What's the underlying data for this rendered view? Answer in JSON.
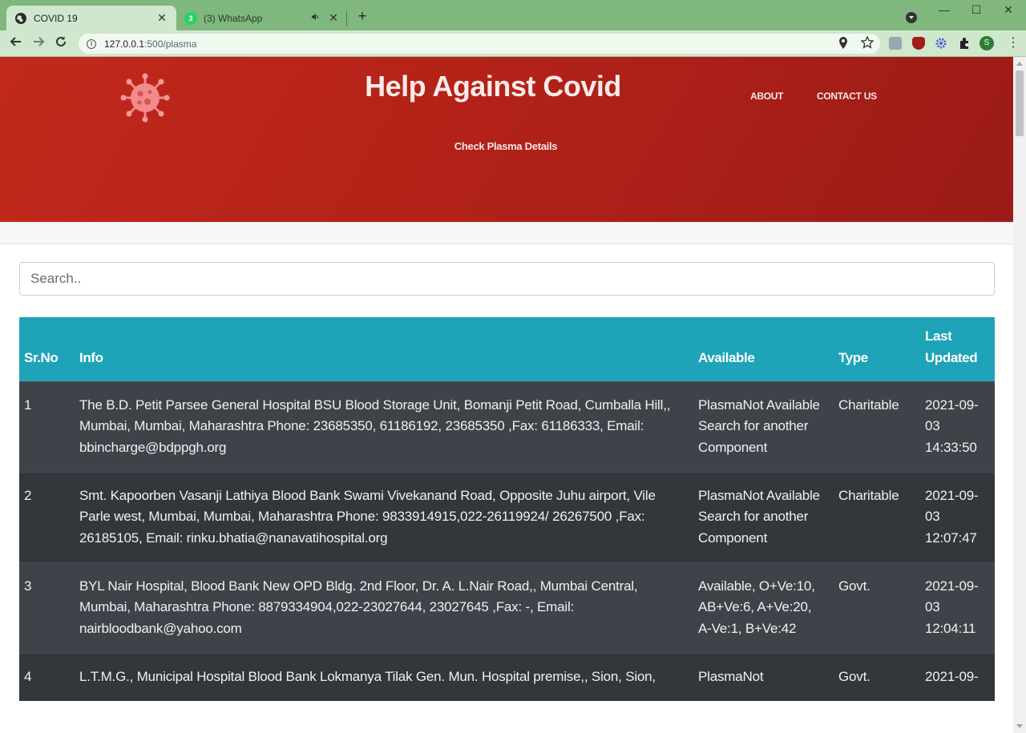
{
  "browser": {
    "tabs": [
      {
        "title": "COVID 19",
        "close": "✕"
      },
      {
        "title": "(3) WhatsApp",
        "badge": "3",
        "close": "✕"
      }
    ],
    "new_tab": "+",
    "url_host": "127.0.0.1",
    "url_rest": ":500/plasma",
    "profile_initial": "S",
    "window_controls": {
      "minimize": "—",
      "maximize": "☐",
      "close": "✕"
    }
  },
  "site": {
    "brand": "Help Against Covid",
    "nav": {
      "about": "ABOUT",
      "contact": "CONTACT US"
    },
    "plasma_link": "Check Plasma Details"
  },
  "search": {
    "placeholder": "Search.."
  },
  "table": {
    "headers": {
      "srno": "Sr.No",
      "info": "Info",
      "available": "Available",
      "type": "Type",
      "updated": "Last Updated"
    },
    "rows": [
      {
        "srno": "1",
        "info": "The B.D. Petit Parsee General Hospital BSU Blood Storage Unit, Bomanji Petit Road, Cumballa Hill,, Mumbai, Mumbai, Maharashtra Phone: 23685350, 61186192, 23685350 ,Fax: 61186333, Email: bbincharge@bdppgh.org",
        "available": "PlasmaNot Available Search for another Component",
        "type": "Charitable",
        "updated": "2021-09-03 14:33:50"
      },
      {
        "srno": "2",
        "info": "Smt. Kapoorben Vasanji Lathiya Blood Bank Swami Vivekanand Road, Opposite Juhu airport, Vile Parle west, Mumbai, Mumbai, Maharashtra Phone: 9833914915,022-26119924/ 26267500 ,Fax: 26185105, Email: rinku.bhatia@nanavatihospital.org",
        "available": "PlasmaNot Available Search for another Component",
        "type": "Charitable",
        "updated": "2021-09-03 12:07:47"
      },
      {
        "srno": "3",
        "info": "BYL Nair Hospital, Blood Bank New OPD Bldg. 2nd Floor, Dr. A. L.Nair Road,, Mumbai Central, Mumbai, Maharashtra Phone: 8879334904,022-23027644, 23027645 ,Fax: -, Email: nairbloodbank@yahoo.com",
        "available": "Available, O+Ve:10, AB+Ve:6, A+Ve:20, A-Ve:1, B+Ve:42",
        "type": "Govt.",
        "updated": "2021-09-03 12:04:11"
      },
      {
        "srno": "4",
        "info": "L.T.M.G., Municipal Hospital Blood Bank Lokmanya Tilak Gen. Mun. Hospital premise,, Sion, Sion,",
        "available": "PlasmaNot",
        "type": "Govt.",
        "updated": "2021-09-"
      }
    ]
  }
}
